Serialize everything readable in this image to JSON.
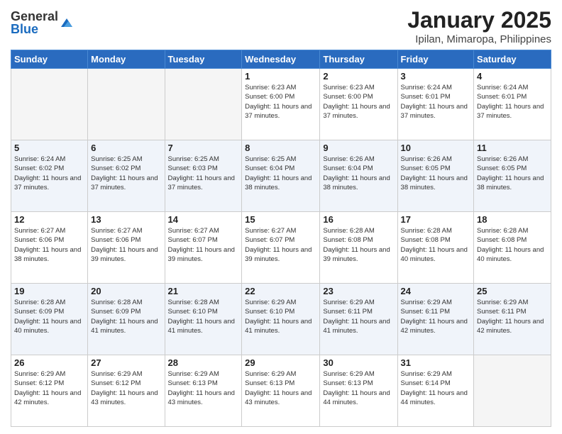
{
  "logo": {
    "general": "General",
    "blue": "Blue"
  },
  "title": {
    "month": "January 2025",
    "location": "Ipilan, Mimaropa, Philippines"
  },
  "days_of_week": [
    "Sunday",
    "Monday",
    "Tuesday",
    "Wednesday",
    "Thursday",
    "Friday",
    "Saturday"
  ],
  "weeks": [
    [
      {
        "day": "",
        "sunrise": "",
        "sunset": "",
        "daylight": "",
        "empty": true
      },
      {
        "day": "",
        "sunrise": "",
        "sunset": "",
        "daylight": "",
        "empty": true
      },
      {
        "day": "",
        "sunrise": "",
        "sunset": "",
        "daylight": "",
        "empty": true
      },
      {
        "day": "1",
        "sunrise": "Sunrise: 6:23 AM",
        "sunset": "Sunset: 6:00 PM",
        "daylight": "Daylight: 11 hours and 37 minutes.",
        "empty": false
      },
      {
        "day": "2",
        "sunrise": "Sunrise: 6:23 AM",
        "sunset": "Sunset: 6:00 PM",
        "daylight": "Daylight: 11 hours and 37 minutes.",
        "empty": false
      },
      {
        "day": "3",
        "sunrise": "Sunrise: 6:24 AM",
        "sunset": "Sunset: 6:01 PM",
        "daylight": "Daylight: 11 hours and 37 minutes.",
        "empty": false
      },
      {
        "day": "4",
        "sunrise": "Sunrise: 6:24 AM",
        "sunset": "Sunset: 6:01 PM",
        "daylight": "Daylight: 11 hours and 37 minutes.",
        "empty": false
      }
    ],
    [
      {
        "day": "5",
        "sunrise": "Sunrise: 6:24 AM",
        "sunset": "Sunset: 6:02 PM",
        "daylight": "Daylight: 11 hours and 37 minutes.",
        "empty": false
      },
      {
        "day": "6",
        "sunrise": "Sunrise: 6:25 AM",
        "sunset": "Sunset: 6:02 PM",
        "daylight": "Daylight: 11 hours and 37 minutes.",
        "empty": false
      },
      {
        "day": "7",
        "sunrise": "Sunrise: 6:25 AM",
        "sunset": "Sunset: 6:03 PM",
        "daylight": "Daylight: 11 hours and 37 minutes.",
        "empty": false
      },
      {
        "day": "8",
        "sunrise": "Sunrise: 6:25 AM",
        "sunset": "Sunset: 6:04 PM",
        "daylight": "Daylight: 11 hours and 38 minutes.",
        "empty": false
      },
      {
        "day": "9",
        "sunrise": "Sunrise: 6:26 AM",
        "sunset": "Sunset: 6:04 PM",
        "daylight": "Daylight: 11 hours and 38 minutes.",
        "empty": false
      },
      {
        "day": "10",
        "sunrise": "Sunrise: 6:26 AM",
        "sunset": "Sunset: 6:05 PM",
        "daylight": "Daylight: 11 hours and 38 minutes.",
        "empty": false
      },
      {
        "day": "11",
        "sunrise": "Sunrise: 6:26 AM",
        "sunset": "Sunset: 6:05 PM",
        "daylight": "Daylight: 11 hours and 38 minutes.",
        "empty": false
      }
    ],
    [
      {
        "day": "12",
        "sunrise": "Sunrise: 6:27 AM",
        "sunset": "Sunset: 6:06 PM",
        "daylight": "Daylight: 11 hours and 38 minutes.",
        "empty": false
      },
      {
        "day": "13",
        "sunrise": "Sunrise: 6:27 AM",
        "sunset": "Sunset: 6:06 PM",
        "daylight": "Daylight: 11 hours and 39 minutes.",
        "empty": false
      },
      {
        "day": "14",
        "sunrise": "Sunrise: 6:27 AM",
        "sunset": "Sunset: 6:07 PM",
        "daylight": "Daylight: 11 hours and 39 minutes.",
        "empty": false
      },
      {
        "day": "15",
        "sunrise": "Sunrise: 6:27 AM",
        "sunset": "Sunset: 6:07 PM",
        "daylight": "Daylight: 11 hours and 39 minutes.",
        "empty": false
      },
      {
        "day": "16",
        "sunrise": "Sunrise: 6:28 AM",
        "sunset": "Sunset: 6:08 PM",
        "daylight": "Daylight: 11 hours and 39 minutes.",
        "empty": false
      },
      {
        "day": "17",
        "sunrise": "Sunrise: 6:28 AM",
        "sunset": "Sunset: 6:08 PM",
        "daylight": "Daylight: 11 hours and 40 minutes.",
        "empty": false
      },
      {
        "day": "18",
        "sunrise": "Sunrise: 6:28 AM",
        "sunset": "Sunset: 6:08 PM",
        "daylight": "Daylight: 11 hours and 40 minutes.",
        "empty": false
      }
    ],
    [
      {
        "day": "19",
        "sunrise": "Sunrise: 6:28 AM",
        "sunset": "Sunset: 6:09 PM",
        "daylight": "Daylight: 11 hours and 40 minutes.",
        "empty": false
      },
      {
        "day": "20",
        "sunrise": "Sunrise: 6:28 AM",
        "sunset": "Sunset: 6:09 PM",
        "daylight": "Daylight: 11 hours and 41 minutes.",
        "empty": false
      },
      {
        "day": "21",
        "sunrise": "Sunrise: 6:28 AM",
        "sunset": "Sunset: 6:10 PM",
        "daylight": "Daylight: 11 hours and 41 minutes.",
        "empty": false
      },
      {
        "day": "22",
        "sunrise": "Sunrise: 6:29 AM",
        "sunset": "Sunset: 6:10 PM",
        "daylight": "Daylight: 11 hours and 41 minutes.",
        "empty": false
      },
      {
        "day": "23",
        "sunrise": "Sunrise: 6:29 AM",
        "sunset": "Sunset: 6:11 PM",
        "daylight": "Daylight: 11 hours and 41 minutes.",
        "empty": false
      },
      {
        "day": "24",
        "sunrise": "Sunrise: 6:29 AM",
        "sunset": "Sunset: 6:11 PM",
        "daylight": "Daylight: 11 hours and 42 minutes.",
        "empty": false
      },
      {
        "day": "25",
        "sunrise": "Sunrise: 6:29 AM",
        "sunset": "Sunset: 6:11 PM",
        "daylight": "Daylight: 11 hours and 42 minutes.",
        "empty": false
      }
    ],
    [
      {
        "day": "26",
        "sunrise": "Sunrise: 6:29 AM",
        "sunset": "Sunset: 6:12 PM",
        "daylight": "Daylight: 11 hours and 42 minutes.",
        "empty": false
      },
      {
        "day": "27",
        "sunrise": "Sunrise: 6:29 AM",
        "sunset": "Sunset: 6:12 PM",
        "daylight": "Daylight: 11 hours and 43 minutes.",
        "empty": false
      },
      {
        "day": "28",
        "sunrise": "Sunrise: 6:29 AM",
        "sunset": "Sunset: 6:13 PM",
        "daylight": "Daylight: 11 hours and 43 minutes.",
        "empty": false
      },
      {
        "day": "29",
        "sunrise": "Sunrise: 6:29 AM",
        "sunset": "Sunset: 6:13 PM",
        "daylight": "Daylight: 11 hours and 43 minutes.",
        "empty": false
      },
      {
        "day": "30",
        "sunrise": "Sunrise: 6:29 AM",
        "sunset": "Sunset: 6:13 PM",
        "daylight": "Daylight: 11 hours and 44 minutes.",
        "empty": false
      },
      {
        "day": "31",
        "sunrise": "Sunrise: 6:29 AM",
        "sunset": "Sunset: 6:14 PM",
        "daylight": "Daylight: 11 hours and 44 minutes.",
        "empty": false
      },
      {
        "day": "",
        "sunrise": "",
        "sunset": "",
        "daylight": "",
        "empty": true
      }
    ]
  ]
}
